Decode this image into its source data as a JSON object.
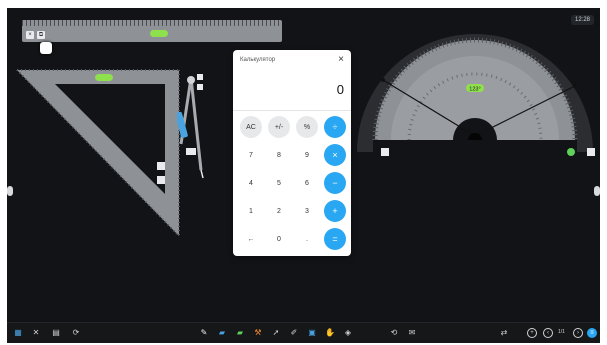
{
  "clock": {
    "time": "12:28"
  },
  "calculator": {
    "title": "Калькулятор",
    "close": "×",
    "display": "0",
    "keys": [
      {
        "label": "AC",
        "kind": "fn"
      },
      {
        "label": "+/-",
        "kind": "fn"
      },
      {
        "label": "%",
        "kind": "fn"
      },
      {
        "label": "÷",
        "kind": "op"
      },
      {
        "label": "7",
        "kind": "num"
      },
      {
        "label": "8",
        "kind": "num"
      },
      {
        "label": "9",
        "kind": "num"
      },
      {
        "label": "×",
        "kind": "op"
      },
      {
        "label": "4",
        "kind": "num"
      },
      {
        "label": "5",
        "kind": "num"
      },
      {
        "label": "6",
        "kind": "num"
      },
      {
        "label": "−",
        "kind": "op"
      },
      {
        "label": "1",
        "kind": "num"
      },
      {
        "label": "2",
        "kind": "num"
      },
      {
        "label": "3",
        "kind": "num"
      },
      {
        "label": "+",
        "kind": "op"
      },
      {
        "label": "←",
        "kind": "num"
      },
      {
        "label": "0",
        "kind": "num"
      },
      {
        "label": ".",
        "kind": "num"
      },
      {
        "label": "=",
        "kind": "op"
      }
    ]
  },
  "protractor": {
    "angle_label": "123°"
  },
  "toolbar": {
    "page_indicator": "1/1"
  },
  "colors": {
    "accent": "#29a7f2",
    "tool_highlight": "#8ee04d",
    "tool_grey": "#8e9297",
    "background": "#121316"
  },
  "icons": {
    "ruler": [
      "close-icon",
      "copy-icon"
    ],
    "toolbar_left": [
      "grid-icon",
      "tools-icon",
      "table-icon",
      "refresh-icon"
    ],
    "toolbar_center": [
      "pen-icon",
      "eraser-icon",
      "highlighter-icon",
      "hammer-icon",
      "pointer-icon",
      "marker-icon",
      "image-icon",
      "hand-icon",
      "shapes-icon",
      "clear-icon",
      "note-icon"
    ],
    "toolbar_right": [
      "swap-icon",
      "add-page-icon",
      "prev-page-icon",
      "next-page-icon",
      "menu-icon"
    ]
  }
}
